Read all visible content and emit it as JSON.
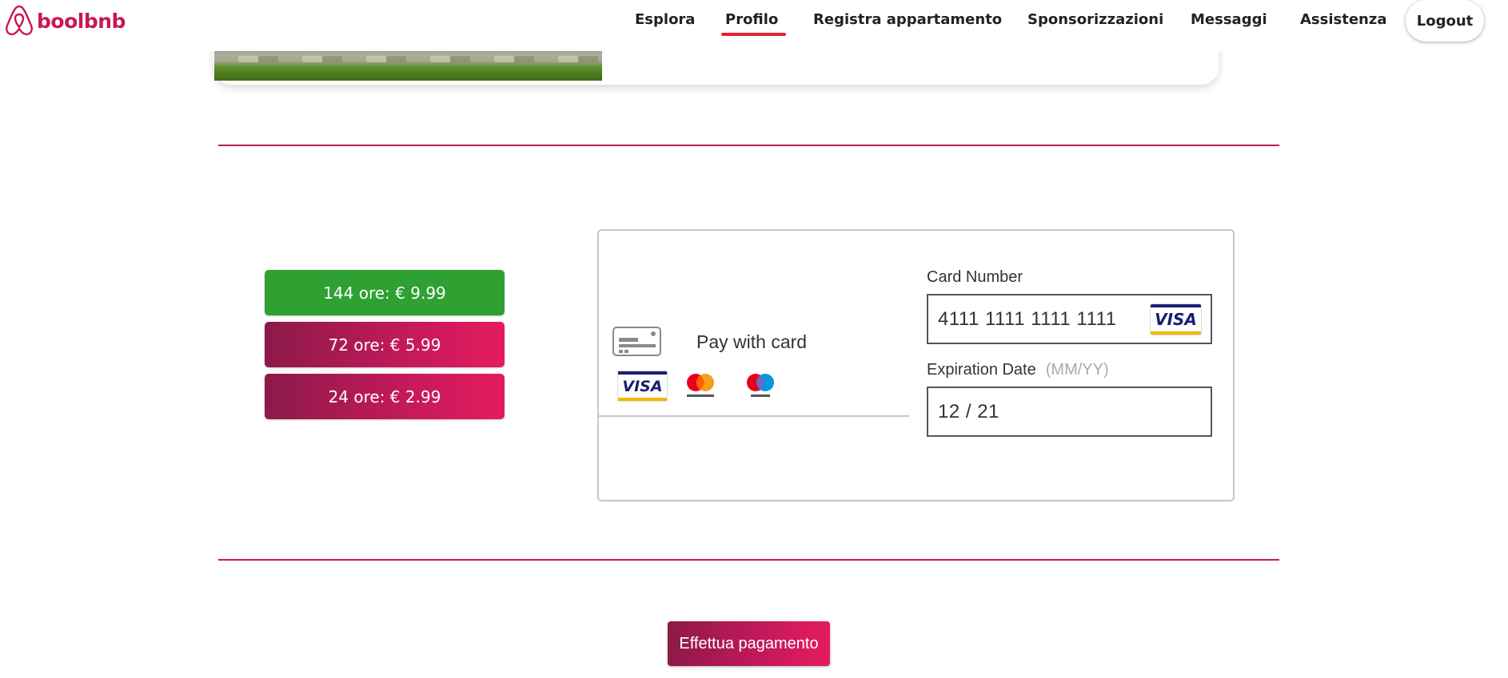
{
  "header": {
    "brand": "boolbnb",
    "nav": [
      {
        "label": "Esplora",
        "active": false
      },
      {
        "label": "Profilo",
        "active": true
      },
      {
        "label": "Registra appartamento",
        "active": false
      },
      {
        "label": "Sponsorizzazioni",
        "active": false
      },
      {
        "label": "Messaggi",
        "active": false
      },
      {
        "label": "Assistenza",
        "active": false
      }
    ],
    "logout": "Logout"
  },
  "sponsorships": [
    {
      "label": "144 ore: € 9.99",
      "selected": true
    },
    {
      "label": "72 ore: € 5.99",
      "selected": false
    },
    {
      "label": "24 ore: € 2.99",
      "selected": false
    }
  ],
  "payment": {
    "method_label": "Pay with card",
    "brands": [
      "visa",
      "mastercard",
      "maestro"
    ],
    "card_number_label": "Card Number",
    "card_number_value": "4111 1111 1111 1111",
    "card_brand_detected": "VISA",
    "expiration_label": "Expiration Date",
    "expiration_hint": "(MM/YY)",
    "expiration_value": "12 / 21"
  },
  "submit_label": "Effettua pagamento",
  "colors": {
    "accent": "#c8184f",
    "selected_option": "#2ea132",
    "gradient_start": "#8c1a48",
    "gradient_end": "#e51c5f",
    "nav_active_underline": "#e0232e"
  }
}
